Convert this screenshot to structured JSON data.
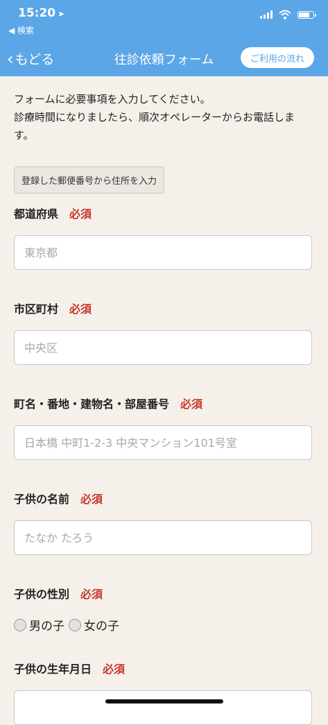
{
  "status": {
    "time": "15:20",
    "back_app": "◀ 検索"
  },
  "nav": {
    "back_label": "もどる",
    "title": "往診依頼フォーム",
    "flow_button": "ご利用の流れ"
  },
  "intro": {
    "line1": "フォームに必要事項を入力してください。",
    "line2": "診療時間になりましたら、順次オペレーターからお電話します。"
  },
  "address_button": "登録した郵便番号から住所を入力",
  "required_label": "必須",
  "fields": {
    "prefecture": {
      "label": "都道府県",
      "placeholder": "東京都"
    },
    "city": {
      "label": "市区町村",
      "placeholder": "中央区"
    },
    "street": {
      "label": "町名・番地・建物名・部屋番号",
      "placeholder": "日本橋 中町1-2-3 中央マンション101号室"
    },
    "child_name": {
      "label": "子供の名前",
      "placeholder": "たなか たろう"
    },
    "child_gender": {
      "label": "子供の性別",
      "options": [
        "男の子",
        "女の子"
      ]
    },
    "child_birthdate": {
      "label": "子供の生年月日",
      "placeholder": ""
    }
  },
  "colors": {
    "header": "#5aa6e6",
    "background": "#f5f1ea",
    "required": "#c8372b"
  }
}
